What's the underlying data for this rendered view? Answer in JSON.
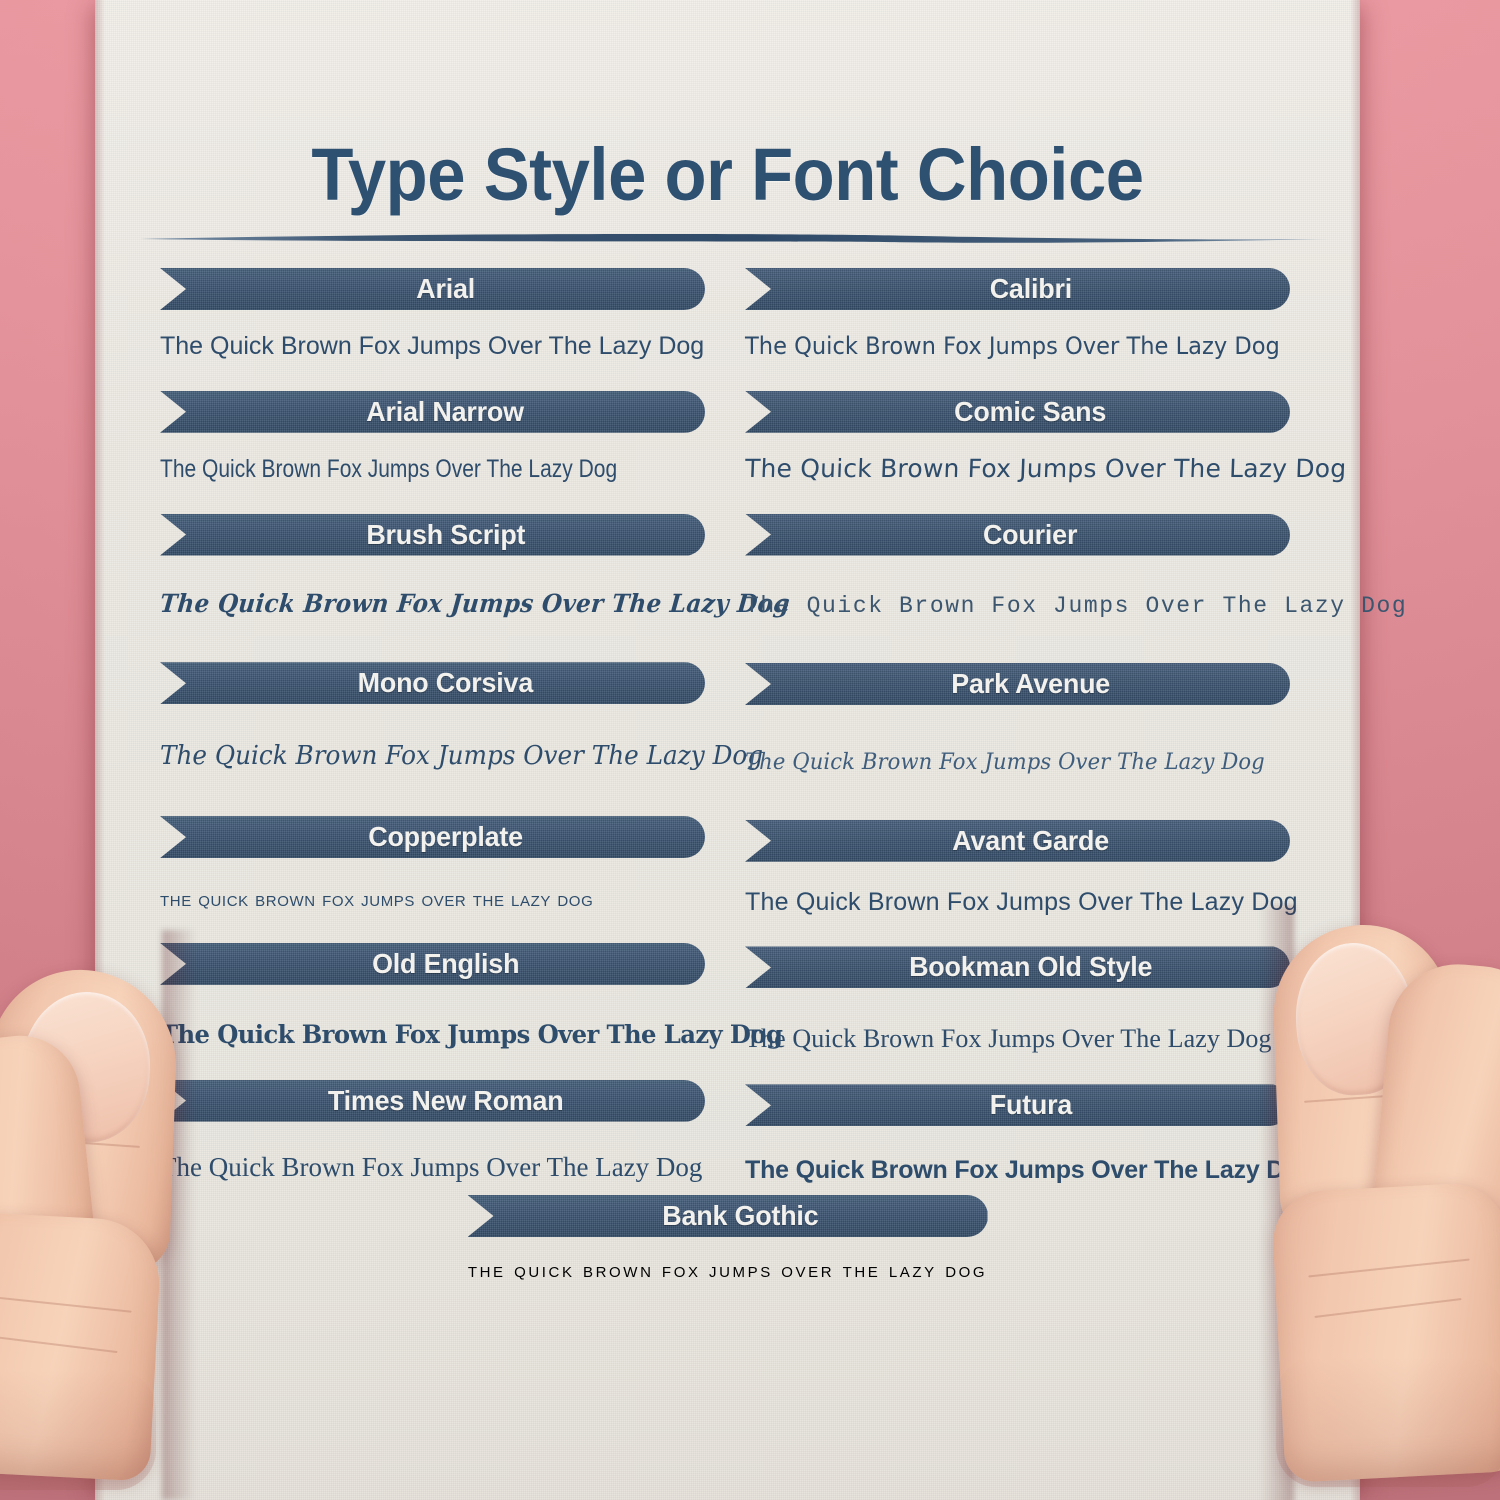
{
  "poster": {
    "title": "Type Style or Font Choice",
    "sample_text": "The Quick Brown Fox Jumps Over The Lazy Dog",
    "colors": {
      "ribbon_navy": "#3e5673",
      "title_navy": "#2f5171",
      "paper": "#edeae3",
      "background_pink": "#e8929a",
      "sample_text": "#2e4c6b",
      "ribbon_label": "#f2f1ee"
    },
    "left_column": [
      {
        "name": "Arial",
        "sample": "The Quick Brown Fox Jumps Over The Lazy Dog"
      },
      {
        "name": "Arial Narrow",
        "sample": "The Quick Brown Fox Jumps Over The Lazy Dog"
      },
      {
        "name": "Brush Script",
        "sample": "The Quick Brown Fox Jumps Over The Lazy Dog"
      },
      {
        "name": "Mono Corsiva",
        "sample": "The Quick Brown Fox Jumps Over The Lazy Dog"
      },
      {
        "name": "Copperplate",
        "sample": "The Quick Brown Fox Jumps Over The Lazy Dog"
      },
      {
        "name": "Old English",
        "sample": "The Quick Brown Fox Jumps Over The Lazy Dog"
      },
      {
        "name": "Times New Roman",
        "sample": "The Quick Brown Fox Jumps Over The Lazy Dog"
      }
    ],
    "right_column": [
      {
        "name": "Calibri",
        "sample": "The Quick Brown Fox Jumps Over The Lazy Dog"
      },
      {
        "name": "Comic Sans",
        "sample": "The Quick Brown Fox Jumps Over The Lazy Dog"
      },
      {
        "name": "Courier",
        "sample": "The Quick Brown Fox Jumps Over The Lazy Dog"
      },
      {
        "name": "Park Avenue",
        "sample": "The Quick Brown Fox Jumps Over The Lazy Dog"
      },
      {
        "name": "Avant Garde",
        "sample": "The Quick Brown Fox Jumps Over The Lazy Dog"
      },
      {
        "name": "Bookman Old Style",
        "sample": "The Quick Brown Fox Jumps Over The Lazy Dog"
      },
      {
        "name": "Futura",
        "sample": "The Quick Brown Fox Jumps Over The Lazy Dog"
      }
    ],
    "bottom": {
      "name": "Bank Gothic",
      "sample": "The Quick Brown Fox Jumps Over The Lazy Dog"
    }
  }
}
